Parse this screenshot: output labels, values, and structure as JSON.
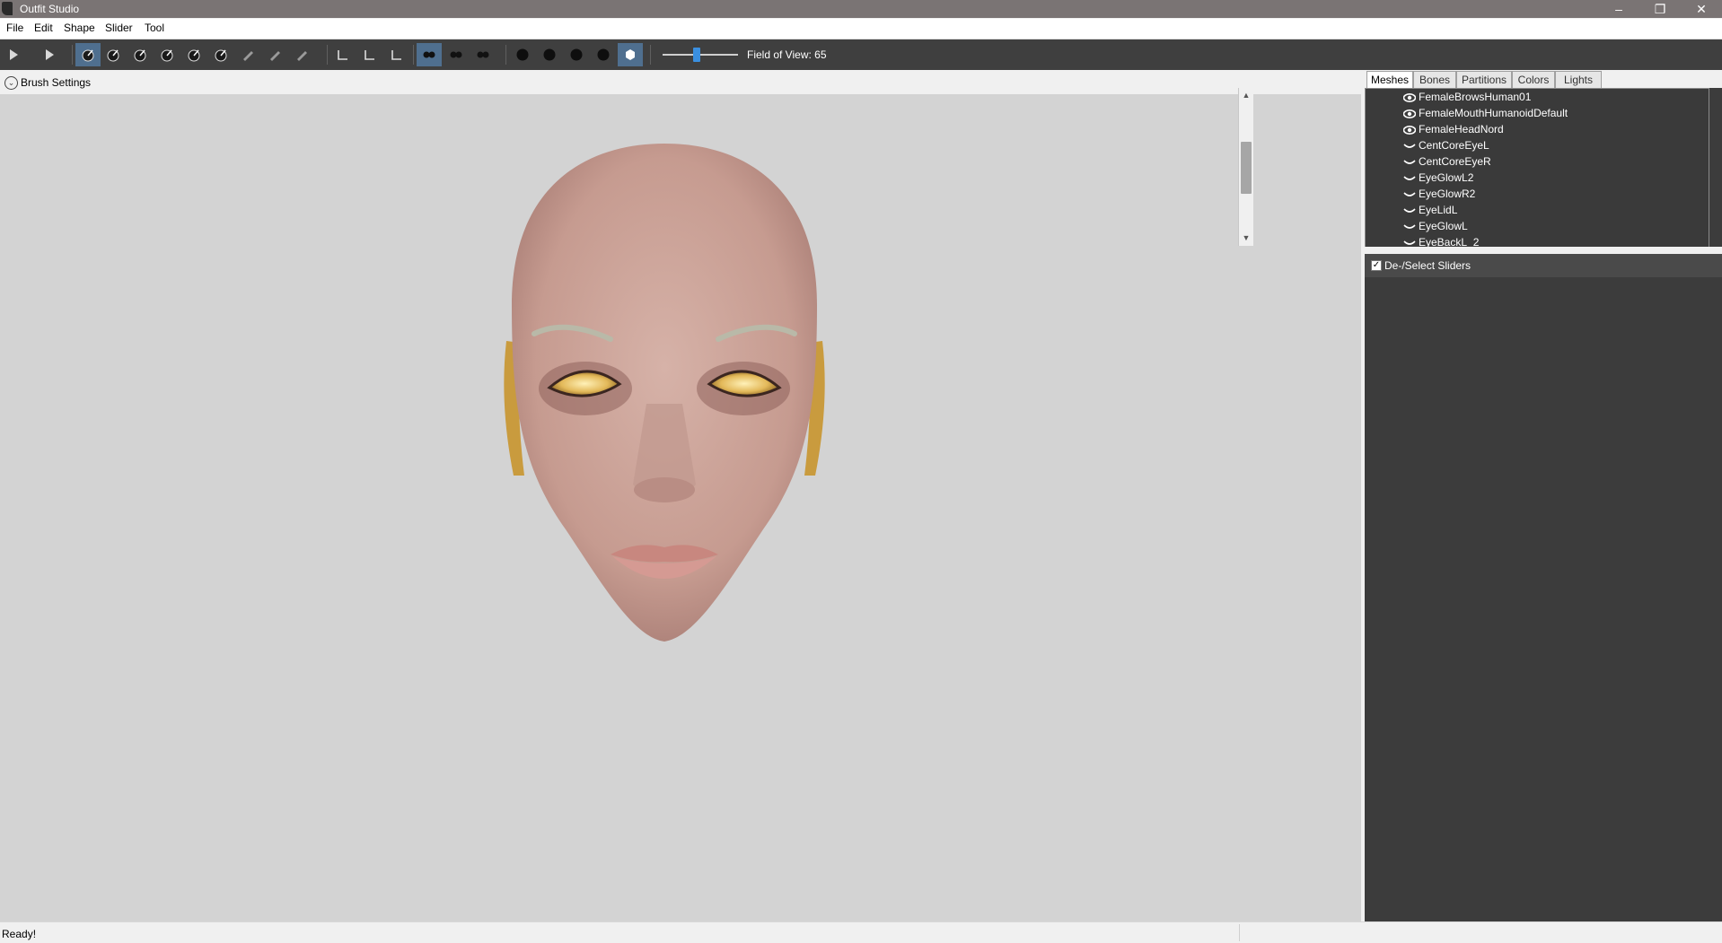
{
  "window": {
    "title": "Outfit Studio"
  },
  "menu": [
    "File",
    "Edit",
    "Shape",
    "Slider",
    "Tool"
  ],
  "toolbar": {
    "tools": [
      {
        "icon": "select-tool-icon",
        "active": false
      },
      {
        "icon": "transform-tool-icon",
        "active": false
      },
      {
        "icon": "standard-brush-icon",
        "active": true
      },
      {
        "icon": "mask-brush-icon",
        "active": false
      },
      {
        "icon": "inflate-brush-icon",
        "active": false
      },
      {
        "icon": "deflate-brush-icon",
        "active": false
      },
      {
        "icon": "move-brush-icon",
        "active": false
      },
      {
        "icon": "smooth-brush-icon",
        "active": false
      },
      {
        "icon": "weight-paint-icon",
        "active": false
      },
      {
        "icon": "color-paint-icon",
        "active": false
      },
      {
        "icon": "alpha-paint-icon",
        "active": false
      },
      {
        "icon": "collapse-vertex-icon",
        "active": false
      },
      {
        "icon": "pin-icon",
        "active": false
      },
      {
        "icon": "edge-tool-icon",
        "active": false
      },
      {
        "icon": "x-mirror-icon",
        "active": true
      },
      {
        "icon": "connected-only-icon",
        "active": false
      },
      {
        "icon": "global-brush-icon",
        "active": false
      },
      {
        "icon": "show-points-icon",
        "active": false
      },
      {
        "icon": "wireframe-icon",
        "active": false
      },
      {
        "icon": "lighting-icon",
        "active": false
      },
      {
        "icon": "textures-icon",
        "active": false
      },
      {
        "icon": "mask-visible-icon",
        "active": true
      }
    ],
    "fov_label": "Field of View: 65",
    "fov_value": 65
  },
  "brush_settings": {
    "label": "Brush Settings"
  },
  "right_panel": {
    "tabs": [
      "Meshes",
      "Bones",
      "Partitions",
      "Colors",
      "Lights"
    ],
    "active_tab": "Meshes",
    "meshes": [
      {
        "name": "FemaleBrowsHuman01",
        "icon": "eye-icon"
      },
      {
        "name": "FemaleMouthHumanoidDefault",
        "icon": "eye-icon"
      },
      {
        "name": "FemaleHeadNord",
        "icon": "eye-icon"
      },
      {
        "name": "CentCoreEyeL",
        "icon": "closed-eye-icon"
      },
      {
        "name": "CentCoreEyeR",
        "icon": "closed-eye-icon"
      },
      {
        "name": "EyeGlowL2",
        "icon": "closed-eye-icon"
      },
      {
        "name": "EyeGlowR2",
        "icon": "closed-eye-icon"
      },
      {
        "name": "EyeLidL",
        "icon": "closed-eye-icon"
      },
      {
        "name": "EyeGlowL",
        "icon": "closed-eye-icon"
      },
      {
        "name": "EyeBackL_2",
        "icon": "closed-eye-icon"
      }
    ],
    "sliders_header": "De-/Select Sliders",
    "sliders_checked": true
  },
  "status": {
    "text": "Ready!"
  },
  "colors": {
    "accent": "#3a8fe0",
    "toolbar": "#3f3f3f",
    "panel": "#3c3c3c",
    "viewport": "#d3d3d3"
  }
}
